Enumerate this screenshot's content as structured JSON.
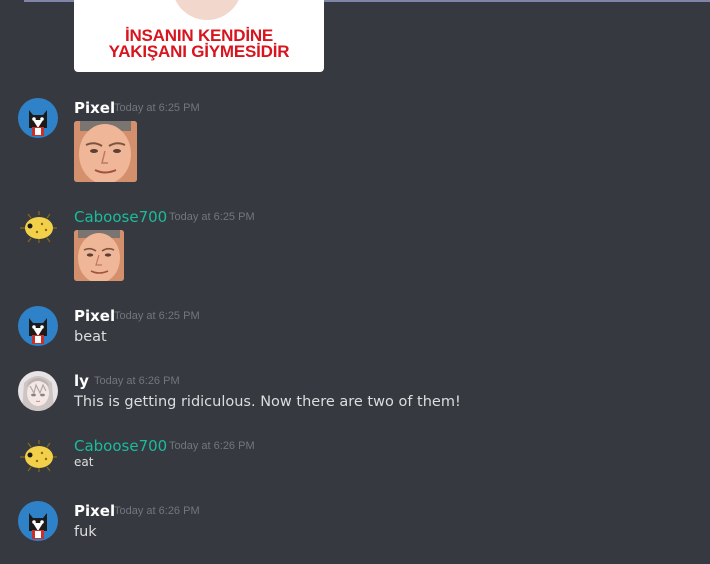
{
  "previous_attachment": {
    "caption_line1": "İNSANIN KENDİNE",
    "caption_line2": "YAKIŞANI GİYMESİDİR"
  },
  "messages": [
    {
      "author": "Pixel",
      "timestamp": "Today at 6:25 PM",
      "content": "",
      "attachment": "face-image"
    },
    {
      "author": "Caboose700",
      "timestamp": "Today at 6:25 PM",
      "content": "",
      "attachment": "face-image"
    },
    {
      "author": "Pixel",
      "timestamp": "Today at 6:25 PM",
      "content": "beat"
    },
    {
      "author": "ly",
      "timestamp": "Today at 6:26 PM",
      "content": "This is getting ridiculous. Now there are two of them!"
    },
    {
      "author": "Caboose700",
      "timestamp": "Today at 6:26 PM",
      "content": "eat"
    },
    {
      "author": "Pixel",
      "timestamp": "Today at 6:26 PM",
      "content": "fuk"
    }
  ],
  "colors": {
    "background": "#36393f",
    "username_default": "#ffffff",
    "username_caboose": "#1abc9c",
    "timestamp": "#72767d",
    "message_text": "#dcddde"
  },
  "icons": {
    "pixel_avatar": "cat-avatar-icon",
    "caboose_avatar": "pufferfish-avatar-icon",
    "ly_avatar": "anime-girl-avatar-icon"
  }
}
